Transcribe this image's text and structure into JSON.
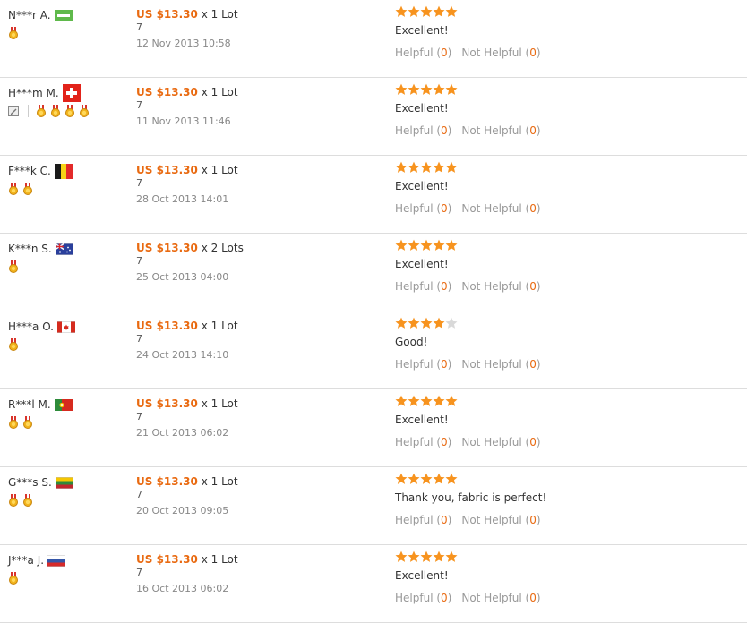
{
  "colors": {
    "accent": "#e96a11",
    "star_on": "#f7931e",
    "star_off": "#d9d9d9",
    "muted": "#999999",
    "divider": "#dddddd"
  },
  "helpful_label": "Helpful",
  "not_helpful_label": "Not Helpful",
  "feedback": [
    {
      "buyer": "N***r A.",
      "flag": "flag-green-white",
      "medals": 1,
      "edit_badge": false,
      "price": "US $13.30",
      "qty": "x 1 Lot",
      "qty_sub": "7",
      "date": "12 Nov 2013 10:58",
      "rating": 5,
      "comment": "Excellent!",
      "helpful": "0",
      "not_helpful": "0"
    },
    {
      "buyer": "H***m M.",
      "flag": "flag-switzerland",
      "medals": 4,
      "edit_badge": true,
      "price": "US $13.30",
      "qty": "x 1 Lot",
      "qty_sub": "7",
      "date": "11 Nov 2013 11:46",
      "rating": 5,
      "comment": "Excellent!",
      "helpful": "0",
      "not_helpful": "0"
    },
    {
      "buyer": "F***k C.",
      "flag": "flag-belgium",
      "medals": 2,
      "edit_badge": false,
      "price": "US $13.30",
      "qty": "x 1 Lot",
      "qty_sub": "7",
      "date": "28 Oct 2013 14:01",
      "rating": 5,
      "comment": "Excellent!",
      "helpful": "0",
      "not_helpful": "0"
    },
    {
      "buyer": "K***n S.",
      "flag": "flag-australia",
      "medals": 1,
      "edit_badge": false,
      "price": "US $13.30",
      "qty": "x 2 Lots",
      "qty_sub": "7",
      "date": "25 Oct 2013 04:00",
      "rating": 5,
      "comment": "Excellent!",
      "helpful": "0",
      "not_helpful": "0"
    },
    {
      "buyer": "H***a O.",
      "flag": "flag-canada",
      "medals": 1,
      "edit_badge": false,
      "price": "US $13.30",
      "qty": "x 1 Lot",
      "qty_sub": "7",
      "date": "24 Oct 2013 14:10",
      "rating": 4,
      "comment": "Good!",
      "helpful": "0",
      "not_helpful": "0"
    },
    {
      "buyer": "R***l M.",
      "flag": "flag-portugal",
      "medals": 2,
      "edit_badge": false,
      "price": "US $13.30",
      "qty": "x 1 Lot",
      "qty_sub": "7",
      "date": "21 Oct 2013 06:02",
      "rating": 5,
      "comment": "Excellent!",
      "helpful": "0",
      "not_helpful": "0"
    },
    {
      "buyer": "G***s S.",
      "flag": "flag-lithuania",
      "medals": 2,
      "edit_badge": false,
      "price": "US $13.30",
      "qty": "x 1 Lot",
      "qty_sub": "7",
      "date": "20 Oct 2013 09:05",
      "rating": 5,
      "comment": "Thank you, fabric is perfect!",
      "helpful": "0",
      "not_helpful": "0"
    },
    {
      "buyer": "J***a J.",
      "flag": "flag-russia",
      "medals": 1,
      "edit_badge": false,
      "price": "US $13.30",
      "qty": "x 1 Lot",
      "qty_sub": "7",
      "date": "16 Oct 2013 06:02",
      "rating": 5,
      "comment": "Excellent!",
      "helpful": "0",
      "not_helpful": "0"
    }
  ]
}
